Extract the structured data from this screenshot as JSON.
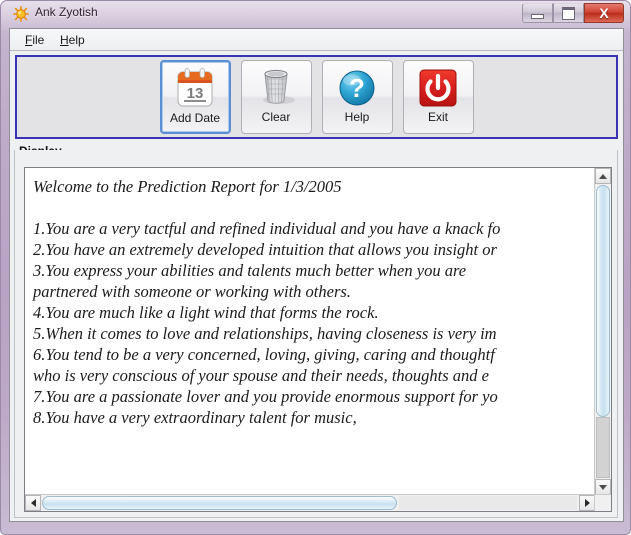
{
  "window": {
    "title": "Ank Zyotish",
    "icon": "sun-icon",
    "controls": {
      "minimize_label": "Minimize",
      "maximize_label": "Maximize",
      "close_label": "X"
    }
  },
  "menu": {
    "items": [
      {
        "label": "File",
        "mnemonic": "F",
        "rest": "ile"
      },
      {
        "label": "Help",
        "mnemonic": "H",
        "rest": "elp"
      }
    ]
  },
  "toolbar": {
    "buttons": [
      {
        "label": "Add Date",
        "icon": "calendar-icon",
        "focused": true
      },
      {
        "label": "Clear",
        "icon": "trash-bin-icon",
        "focused": false
      },
      {
        "label": "Help",
        "icon": "question-mark-icon",
        "focused": false
      },
      {
        "label": "Exit",
        "icon": "power-off-icon",
        "focused": false
      }
    ]
  },
  "display": {
    "group_label": "Display",
    "report": {
      "title": "Welcome to the Prediction Report for 1/3/2005",
      "date": "1/3/2005",
      "lines": [
        "1.You are a very tactful and refined individual and you have a knack fo",
        "2.You have an extremely developed intuition that allows you insight or",
        "3.You express your abilities and talents much better when you are",
        "   partnered with someone or working with others.",
        "4.You are much like a light wind that forms the rock.",
        "5.When it comes to love and relationships, having closeness is very im",
        "6.You tend to be a very concerned, loving, giving, caring and thoughtf",
        "   who is very conscious of your spouse and their needs, thoughts and e",
        "7.You are a passionate lover and you provide enormous support for yo",
        "8.You have a very extraordinary talent for music,"
      ]
    }
  },
  "scrollbars": {
    "vertical": {
      "up_arrow": "▲",
      "down_arrow": "▼"
    },
    "horizontal": {
      "left_arrow": "◀",
      "right_arrow": "▶"
    }
  },
  "colors": {
    "frame": "#bda9c8",
    "toolbar_border": "#3b32b5",
    "focus_border": "#5b8fd4",
    "close_button": "#c0392b",
    "exit_icon": "#d81e1e",
    "help_icon": "#1f93c4",
    "calendar_top": "#d9541f",
    "scroll_thumb": "#c5e0ef"
  }
}
